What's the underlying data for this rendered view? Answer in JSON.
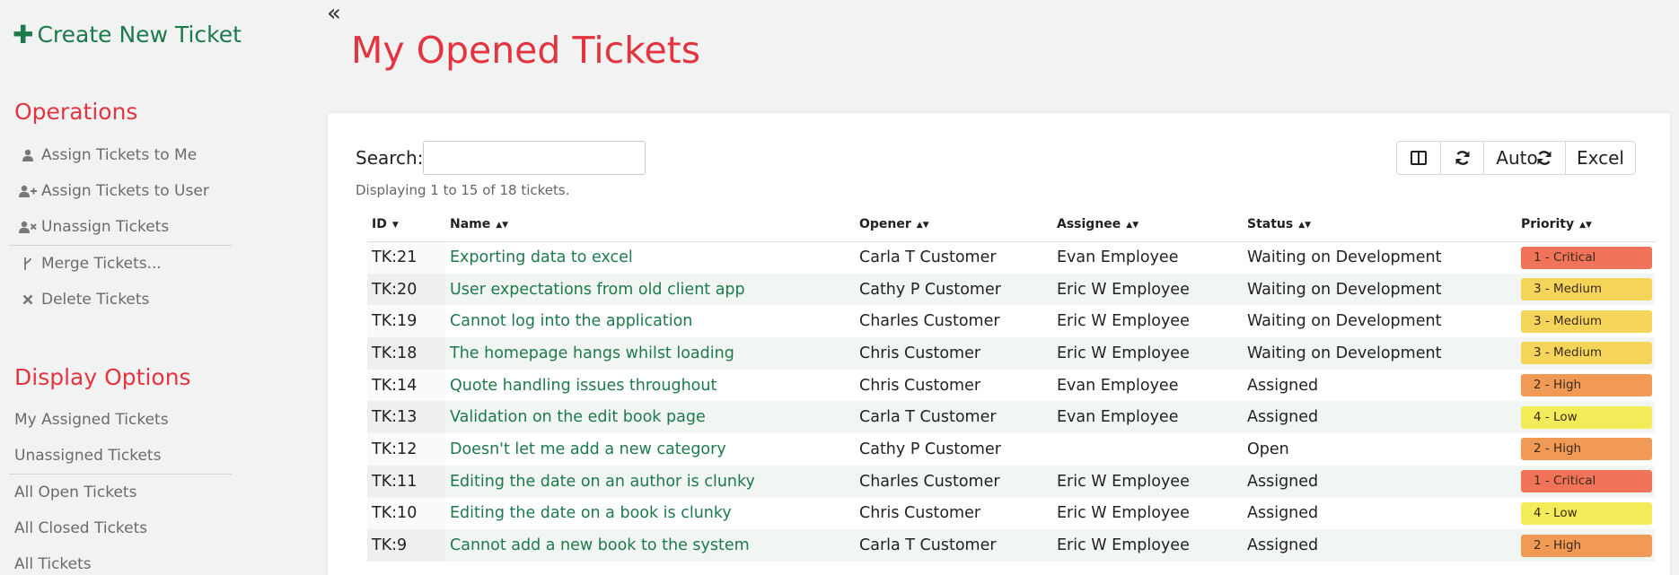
{
  "sidebar": {
    "create_label": "Create New Ticket",
    "operations_heading": "Operations",
    "operations": [
      {
        "label": "Assign Tickets to Me",
        "icon": "user-icon"
      },
      {
        "label": "Assign Tickets to User",
        "icon": "user-plus-icon"
      },
      {
        "label": "Unassign Tickets",
        "icon": "user-x-icon"
      },
      {
        "label": "Merge Tickets...",
        "icon": "merge-icon"
      },
      {
        "label": "Delete Tickets",
        "icon": "x-icon"
      }
    ],
    "display_heading": "Display Options",
    "display_options": [
      {
        "label": "My Assigned Tickets"
      },
      {
        "label": "Unassigned Tickets"
      },
      {
        "label": "All Open Tickets"
      },
      {
        "label": "All Closed Tickets"
      },
      {
        "label": "All Tickets"
      }
    ]
  },
  "page": {
    "title": "My Opened Tickets"
  },
  "toolbar": {
    "search_label": "Search:",
    "search_value": "",
    "display_text": "Displaying 1 to 15 of 18 tickets.",
    "auto_label": "Auto",
    "excel_label": "Excel"
  },
  "table": {
    "headers": {
      "id": "ID",
      "name": "Name",
      "opener": "Opener",
      "assignee": "Assignee",
      "status": "Status",
      "priority": "Priority"
    },
    "rows": [
      {
        "id": "TK:21",
        "name": "Exporting data to excel",
        "opener": "Carla T Customer",
        "assignee": "Evan Employee",
        "status": "Waiting on Development",
        "priority": "1 - Critical"
      },
      {
        "id": "TK:20",
        "name": "User expectations from old client app",
        "opener": "Cathy P Customer",
        "assignee": "Eric W Employee",
        "status": "Waiting on Development",
        "priority": "3 - Medium"
      },
      {
        "id": "TK:19",
        "name": "Cannot log into the application",
        "opener": "Charles Customer",
        "assignee": "Eric W Employee",
        "status": "Waiting on Development",
        "priority": "3 - Medium"
      },
      {
        "id": "TK:18",
        "name": "The homepage hangs whilst loading",
        "opener": "Chris Customer",
        "assignee": "Eric W Employee",
        "status": "Waiting on Development",
        "priority": "3 - Medium"
      },
      {
        "id": "TK:14",
        "name": "Quote handling issues throughout",
        "opener": "Chris Customer",
        "assignee": "Evan Employee",
        "status": "Assigned",
        "priority": "2 - High"
      },
      {
        "id": "TK:13",
        "name": "Validation on the edit book page",
        "opener": "Carla T Customer",
        "assignee": "Evan Employee",
        "status": "Assigned",
        "priority": "4 - Low"
      },
      {
        "id": "TK:12",
        "name": "Doesn't let me add a new category",
        "opener": "Cathy P Customer",
        "assignee": "",
        "status": "Open",
        "priority": "2 - High"
      },
      {
        "id": "TK:11",
        "name": "Editing the date on an author is clunky",
        "opener": "Charles Customer",
        "assignee": "Eric W Employee",
        "status": "Assigned",
        "priority": "1 - Critical"
      },
      {
        "id": "TK:10",
        "name": "Editing the date on a book is clunky",
        "opener": "Chris Customer",
        "assignee": "Eric W Employee",
        "status": "Assigned",
        "priority": "4 - Low"
      },
      {
        "id": "TK:9",
        "name": "Cannot add a new book to the system",
        "opener": "Carla T Customer",
        "assignee": "Eric W Employee",
        "status": "Assigned",
        "priority": "2 - High"
      }
    ]
  },
  "colors": {
    "accent_red": "#e3343f",
    "link_green": "#1d7a4a",
    "priority_critical": "#f0735a",
    "priority_high": "#f19a55",
    "priority_medium": "#f4d55a",
    "priority_low": "#f2ec58"
  }
}
